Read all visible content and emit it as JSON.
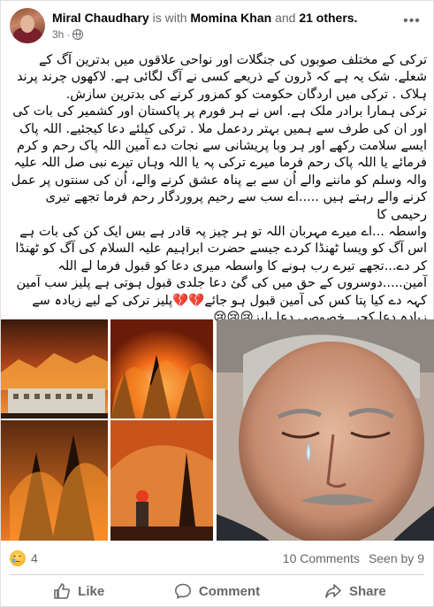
{
  "post": {
    "author": "Miral Chaudhary",
    "with_text": "is with",
    "tagged_person": "Momina Khan",
    "and_text": "and",
    "others": "21 others.",
    "time": "3h",
    "privacy_icon": "globe-icon",
    "more_icon": "more-options-icon",
    "text_lines": [
      "ترکی کے مختلف صوبوں کی جنگلات اور نواحی علاقوں میں بدترین آگ کے",
      "شعلے. شک یہ ہے کہ ڈرون کے ذریعے کسی نے آگ لگائی ہے. لاکھوں چرند پرند",
      "ہلاک . ترکی میں اردگان حکومت کو کمزور کرنے کی بدترین سازش.",
      "ترکی ہمارا برادر ملک ہے. اس نے ہر فورم پر پاکستان اور کشمیر کی بات کی",
      "اور ان کی طرف سے ہمیں بہتر ردعمل ملا . ترکی کیلئے دعا کیجئیے. اللہ پاک",
      "ایسے سلامت رکھے اور ہر وبا پریشانی سے نجات دے آمین اللہ پاک رحم و کرم",
      "فرمائے یا اللہ پاک رحم فرما میرے ترکی پہ یا اللہ وہاں تیرے نبی صل اللہ علیہ",
      "والہ وسلم کو ماننے والے اُن سے بے پناہ عشق کرنے والے، اُن کی سنتوں پر عمل",
      "کرنے والے رہتے ہیں .....اے سب سے رحیم پروردگار رحم فرما تجھے تیری رحیمی کا",
      "واسطہ ...اے میرے مہربان اللہ تو ہر چیز پہ قادر ہے بس ایک کن کی بات ہے",
      "اس آگ کو ویسا ٹھنڈا کردے جیسے حضرت ابراہیم علیہ السلام کی آگ کو ٹھنڈا",
      "کر دے...تجھے تیرے رب ہونے کا واسطہ میری دعا کو قبول فرما لے اللہ",
      "آمین.....دوسروں کے حق میں کی گئ دعا جلدی قبول ہوتی ہے پلیز سب آمین",
      "کہہ دے کیا پتا کس کی آمین قبول ہو جائے💔💔پلیز ترکی کے لیے زیادہ سے",
      "زیادہ دعا کجیے خصوصی دعا پلیز😢😢😢"
    ]
  },
  "stats": {
    "reaction_icon": "crying-face-icon",
    "reaction_count": "4",
    "comments": "10 Comments",
    "seen": "Seen by 9"
  },
  "actions": {
    "like": "Like",
    "comment": "Comment",
    "share": "Share"
  },
  "colors": {
    "text_primary": "#050505",
    "text_secondary": "#65676b",
    "divider": "#ced0d4",
    "fire_orange": "#e8631c"
  }
}
